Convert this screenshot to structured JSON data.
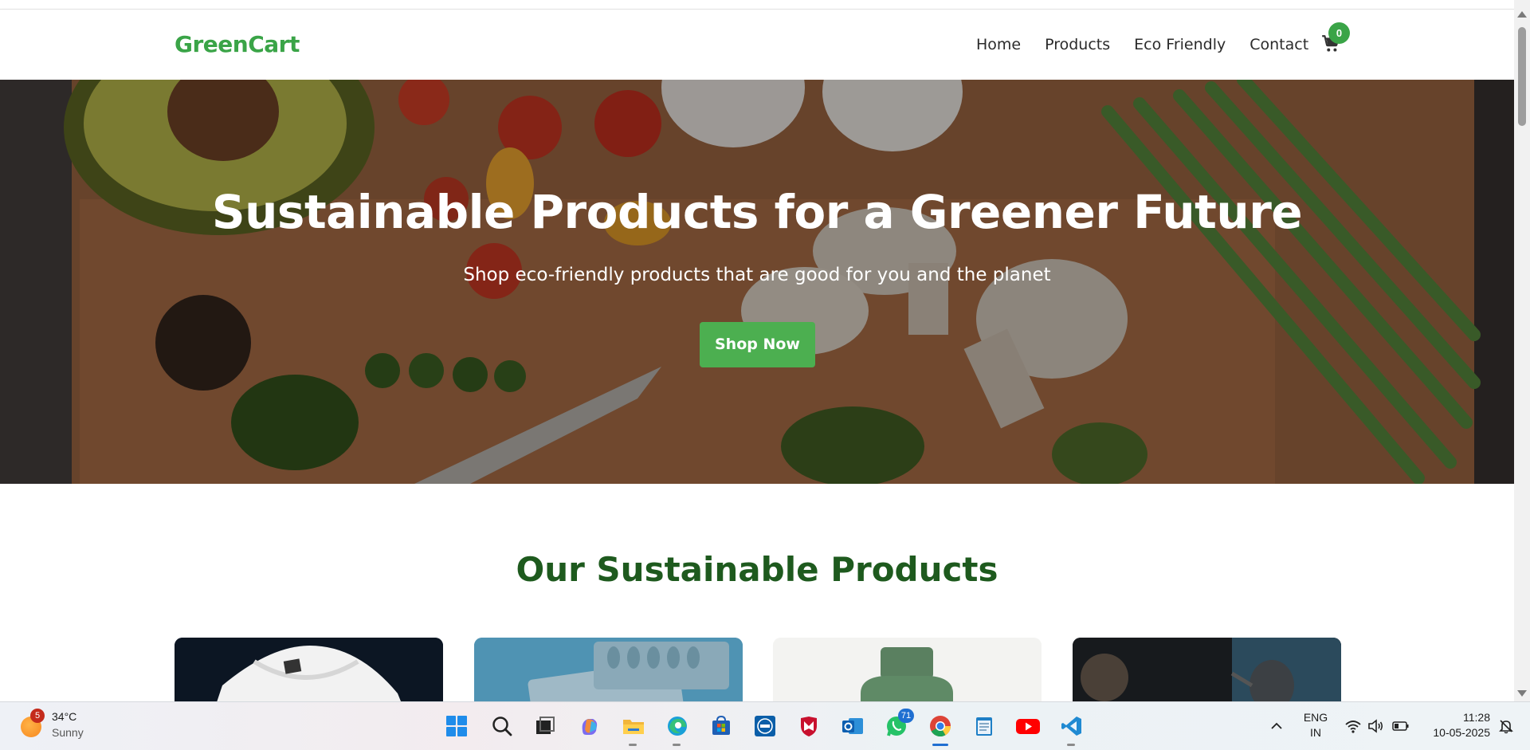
{
  "site": {
    "logo": "GreenCart",
    "nav": [
      "Home",
      "Products",
      "Eco Friendly",
      "Contact"
    ],
    "cart_count": "0"
  },
  "hero": {
    "title": "Sustainable Products for a Greener Future",
    "subtitle": "Shop eco-friendly products that are good for you and the planet",
    "cta": "Shop Now"
  },
  "products": {
    "heading": "Our Sustainable Products"
  },
  "taskbar": {
    "weather_badge": "5",
    "temperature": "34°C",
    "condition": "Sunny",
    "whatsapp_badge": "71",
    "lang_line1": "ENG",
    "lang_line2": "IN",
    "time": "11:28",
    "date": "10-05-2025"
  },
  "colors": {
    "brand": "#3aa447",
    "cta": "#4caf50",
    "heading": "#1e5a1e"
  }
}
